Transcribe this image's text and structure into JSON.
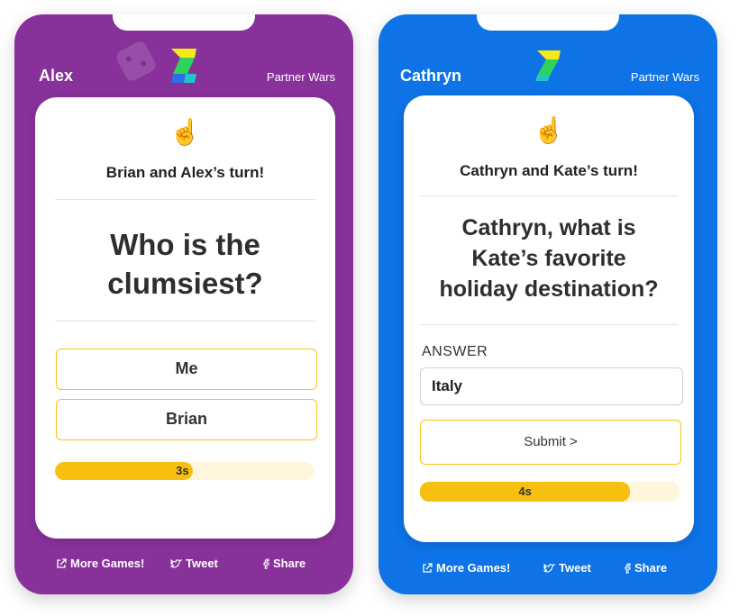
{
  "left": {
    "player": "Alex",
    "mode": "Partner Wars",
    "hand": "☝️",
    "turn": "Brian and Alex’s turn!",
    "question_lines": [
      "Who is the",
      "clumsiest?"
    ],
    "options": [
      "Me",
      "Brian"
    ],
    "timer_label": "3s",
    "timer_fraction": 0.53,
    "footer": {
      "more_games": "More Games!",
      "tweet": "Tweet",
      "share": "Share"
    },
    "icons": [
      "dice-icon",
      "logo-icon",
      "external-link-icon",
      "twitter-icon",
      "facebook-icon"
    ]
  },
  "right": {
    "player": "Cathryn",
    "mode": "Partner Wars",
    "hand": "☝️",
    "turn": "Cathryn and Kate’s turn!",
    "question_lines": [
      "Cathryn, what is",
      "Kate’s favorite",
      "holiday destination?"
    ],
    "answer_label": "ANSWER",
    "answer_value": "Italy",
    "submit_label": "Submit >",
    "timer_label": "4s",
    "timer_fraction": 0.81,
    "footer": {
      "more_games": "More Games!",
      "tweet": "Tweet",
      "share": "Share"
    },
    "icons": [
      "logo-icon",
      "external-link-icon",
      "twitter-icon",
      "facebook-icon"
    ]
  },
  "colors": {
    "left_bg": "#88319a",
    "right_bg": "#0d73e6",
    "accent": "#f7bf0f",
    "option_border": "#f5c518"
  }
}
